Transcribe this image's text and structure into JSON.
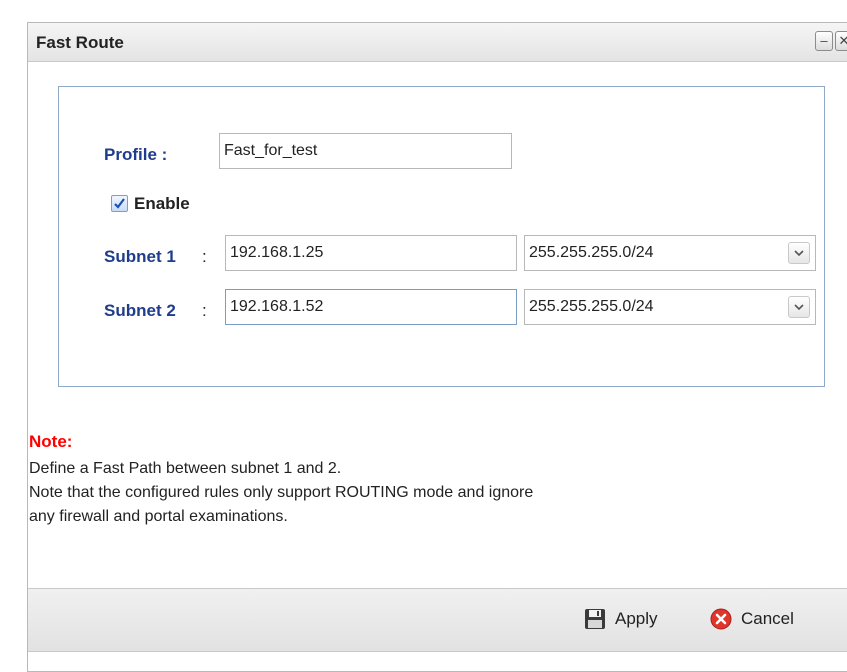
{
  "window": {
    "title": "Fast Route",
    "minimize_glyph": "–",
    "close_glyph": "✕",
    "minimize_icon": "minimize-icon",
    "close_icon": "close-icon"
  },
  "form": {
    "profile_label": "Profile :",
    "profile_value": "Fast_for_test",
    "enable_label": "Enable",
    "enable_checked": true,
    "subnet1_label": "Subnet 1",
    "subnet1_ip": "192.168.1.25",
    "subnet1_mask": "255.255.255.0/24",
    "subnet2_label": "Subnet 2",
    "subnet2_ip": "192.168.1.52",
    "subnet2_mask": "255.255.255.0/24",
    "colon": ":"
  },
  "note": {
    "title": "Note:",
    "line1": "Define a Fast Path between subnet 1 and 2.",
    "line2": "Note that the configured rules only support ROUTING mode and ignore",
    "line3": "any firewall and portal examinations."
  },
  "footer": {
    "apply_label": "Apply",
    "cancel_label": "Cancel",
    "apply_icon": "floppy-disk-icon",
    "cancel_icon": "cancel-circle-icon"
  },
  "colors": {
    "label_blue": "#1f3d8c",
    "note_red": "#ff0000",
    "cancel_red": "#e0352b"
  }
}
